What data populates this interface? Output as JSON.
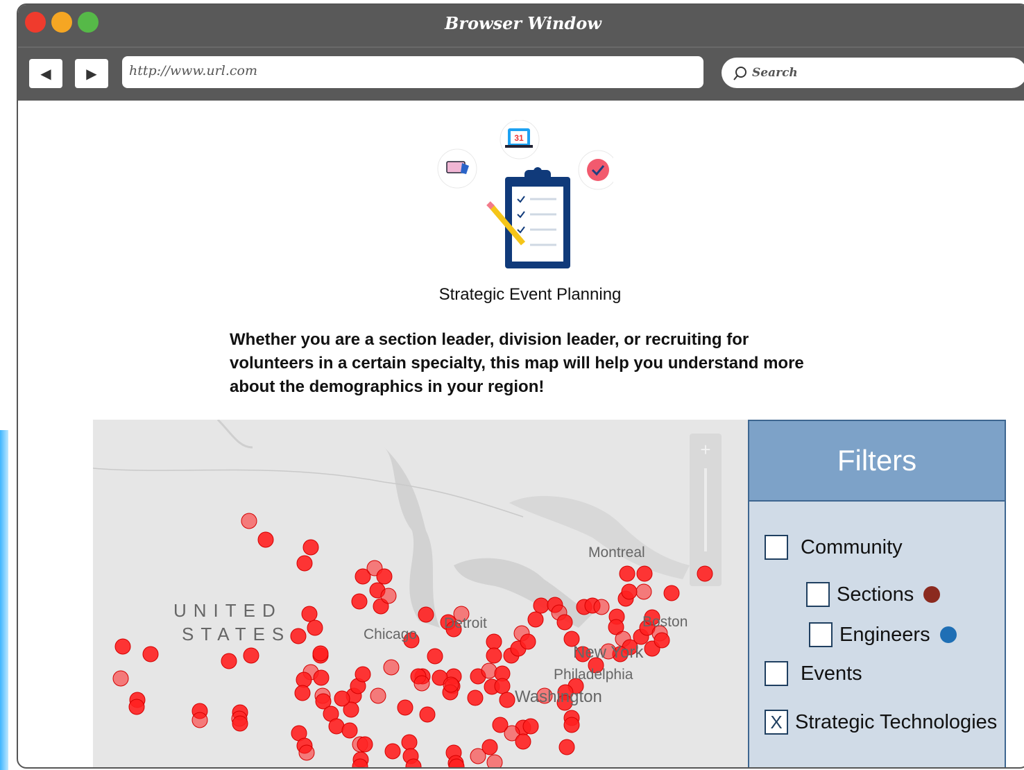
{
  "window": {
    "title": "Browser Window"
  },
  "toolbar": {
    "back_icon": "back-arrow-icon",
    "forward_icon": "forward-arrow-icon",
    "url": "http://www.url.com",
    "search_placeholder": "Search"
  },
  "page": {
    "title": "Strategic Event Planning",
    "description": "Whether you are a section leader, division leader, or recruiting for volunteers in a certain specialty, this map will help you understand more about the demographics in your region!"
  },
  "hero": {
    "calendar_day": "31"
  },
  "map": {
    "labels": {
      "montreal": "Montreal",
      "boston": "Boston",
      "chicago": "Chicago",
      "detroit": "Detroit",
      "new_york": "New York",
      "philadelphia": "Philadelphia",
      "washington": "Washington",
      "country_line1": "UNITED",
      "country_line2": "STATES"
    },
    "zoom_in": "+",
    "marker_color": "#ff2020"
  },
  "filters": {
    "title": "Filters",
    "items": [
      {
        "label": "Community",
        "checked": false
      },
      {
        "label": "Sections",
        "checked": false,
        "color": "#8b2a1f"
      },
      {
        "label": "Engineers",
        "checked": false,
        "color": "#1f6fb5"
      },
      {
        "label": "Events",
        "checked": false
      },
      {
        "label": "Strategic Technologies",
        "checked": true,
        "mark": "X"
      }
    ]
  }
}
